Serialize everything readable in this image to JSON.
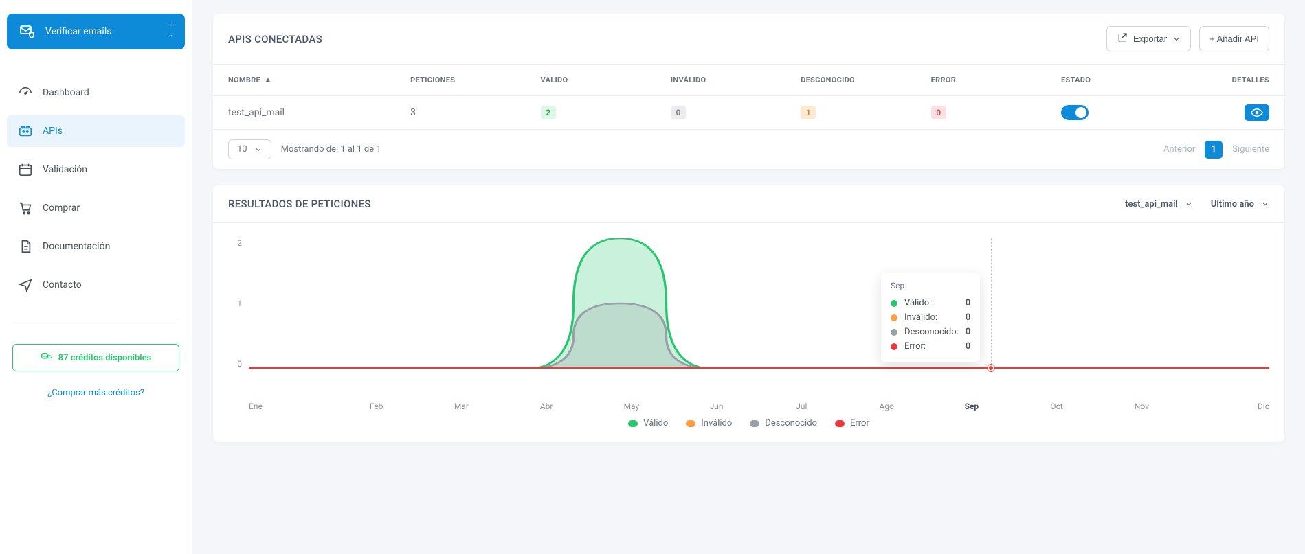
{
  "sidebar": {
    "verify_label": "Verificar emails",
    "items": [
      {
        "label": "Dashboard"
      },
      {
        "label": "APIs"
      },
      {
        "label": "Validación"
      },
      {
        "label": "Comprar"
      },
      {
        "label": "Documentación"
      },
      {
        "label": "Contacto"
      }
    ],
    "credits_label": "87 créditos disponibles",
    "buy_more_label": "¿Comprar más créditos?"
  },
  "apis_card": {
    "title": "APIS CONECTADAS",
    "export_label": "Exportar",
    "add_api_label": "+ Añadir API",
    "columns": {
      "name": "NOMBRE",
      "requests": "PETICIONES",
      "valid": "VÁLIDO",
      "invalid": "INVÁLIDO",
      "unknown": "DESCONOCIDO",
      "error": "ERROR",
      "status": "ESTADO",
      "details": "DETALLES"
    },
    "rows": [
      {
        "name": "test_api_mail",
        "requests": "3",
        "valid": "2",
        "invalid": "0",
        "unknown": "1",
        "error": "0"
      }
    ],
    "page_size": "10",
    "showing_text": "Mostrando del 1 al 1 de 1",
    "prev_label": "Anterior",
    "current_page": "1",
    "next_label": "Siguiente"
  },
  "results_card": {
    "title": "RESULTADOS DE PETICIONES",
    "api_filter": "test_api_mail",
    "range_filter": "Ultimo año",
    "y_ticks": [
      "2",
      "1",
      "0"
    ],
    "x_labels": [
      "Ene",
      "Feb",
      "Mar",
      "Abr",
      "May",
      "Jun",
      "Jul",
      "Ago",
      "Sep",
      "Oct",
      "Nov",
      "Dic"
    ],
    "legend": {
      "valid": "Válido",
      "invalid": "Inválido",
      "unknown": "Desconocido",
      "error": "Error"
    },
    "tooltip": {
      "month": "Sep",
      "valid_label": "Válido:",
      "valid_val": "0",
      "invalid_label": "Inválido:",
      "invalid_val": "0",
      "unknown_label": "Desconocido:",
      "unknown_val": "0",
      "error_label": "Error:",
      "error_val": "0"
    }
  },
  "chart_data": {
    "type": "line",
    "xlabel": "",
    "ylabel": "",
    "ylim": [
      0,
      2
    ],
    "categories": [
      "Ene",
      "Feb",
      "Mar",
      "Abr",
      "May",
      "Jun",
      "Jul",
      "Ago",
      "Sep",
      "Oct",
      "Nov",
      "Dic"
    ],
    "series": [
      {
        "name": "Válido",
        "color": "#28c76f",
        "values": [
          0,
          0,
          0,
          0,
          2,
          0,
          0,
          0,
          0,
          0,
          0,
          0
        ]
      },
      {
        "name": "Inválido",
        "color": "#ff9f43",
        "values": [
          0,
          0,
          0,
          0,
          0,
          0,
          0,
          0,
          0,
          0,
          0,
          0
        ]
      },
      {
        "name": "Desconocido",
        "color": "#9aa0a9",
        "values": [
          0,
          0,
          0,
          0,
          1,
          0,
          0,
          0,
          0,
          0,
          0,
          0
        ]
      },
      {
        "name": "Error",
        "color": "#ea3a3d",
        "values": [
          0,
          0,
          0,
          0,
          0,
          0,
          0,
          0,
          0,
          0,
          0,
          0
        ]
      }
    ],
    "hover_index": 8
  }
}
